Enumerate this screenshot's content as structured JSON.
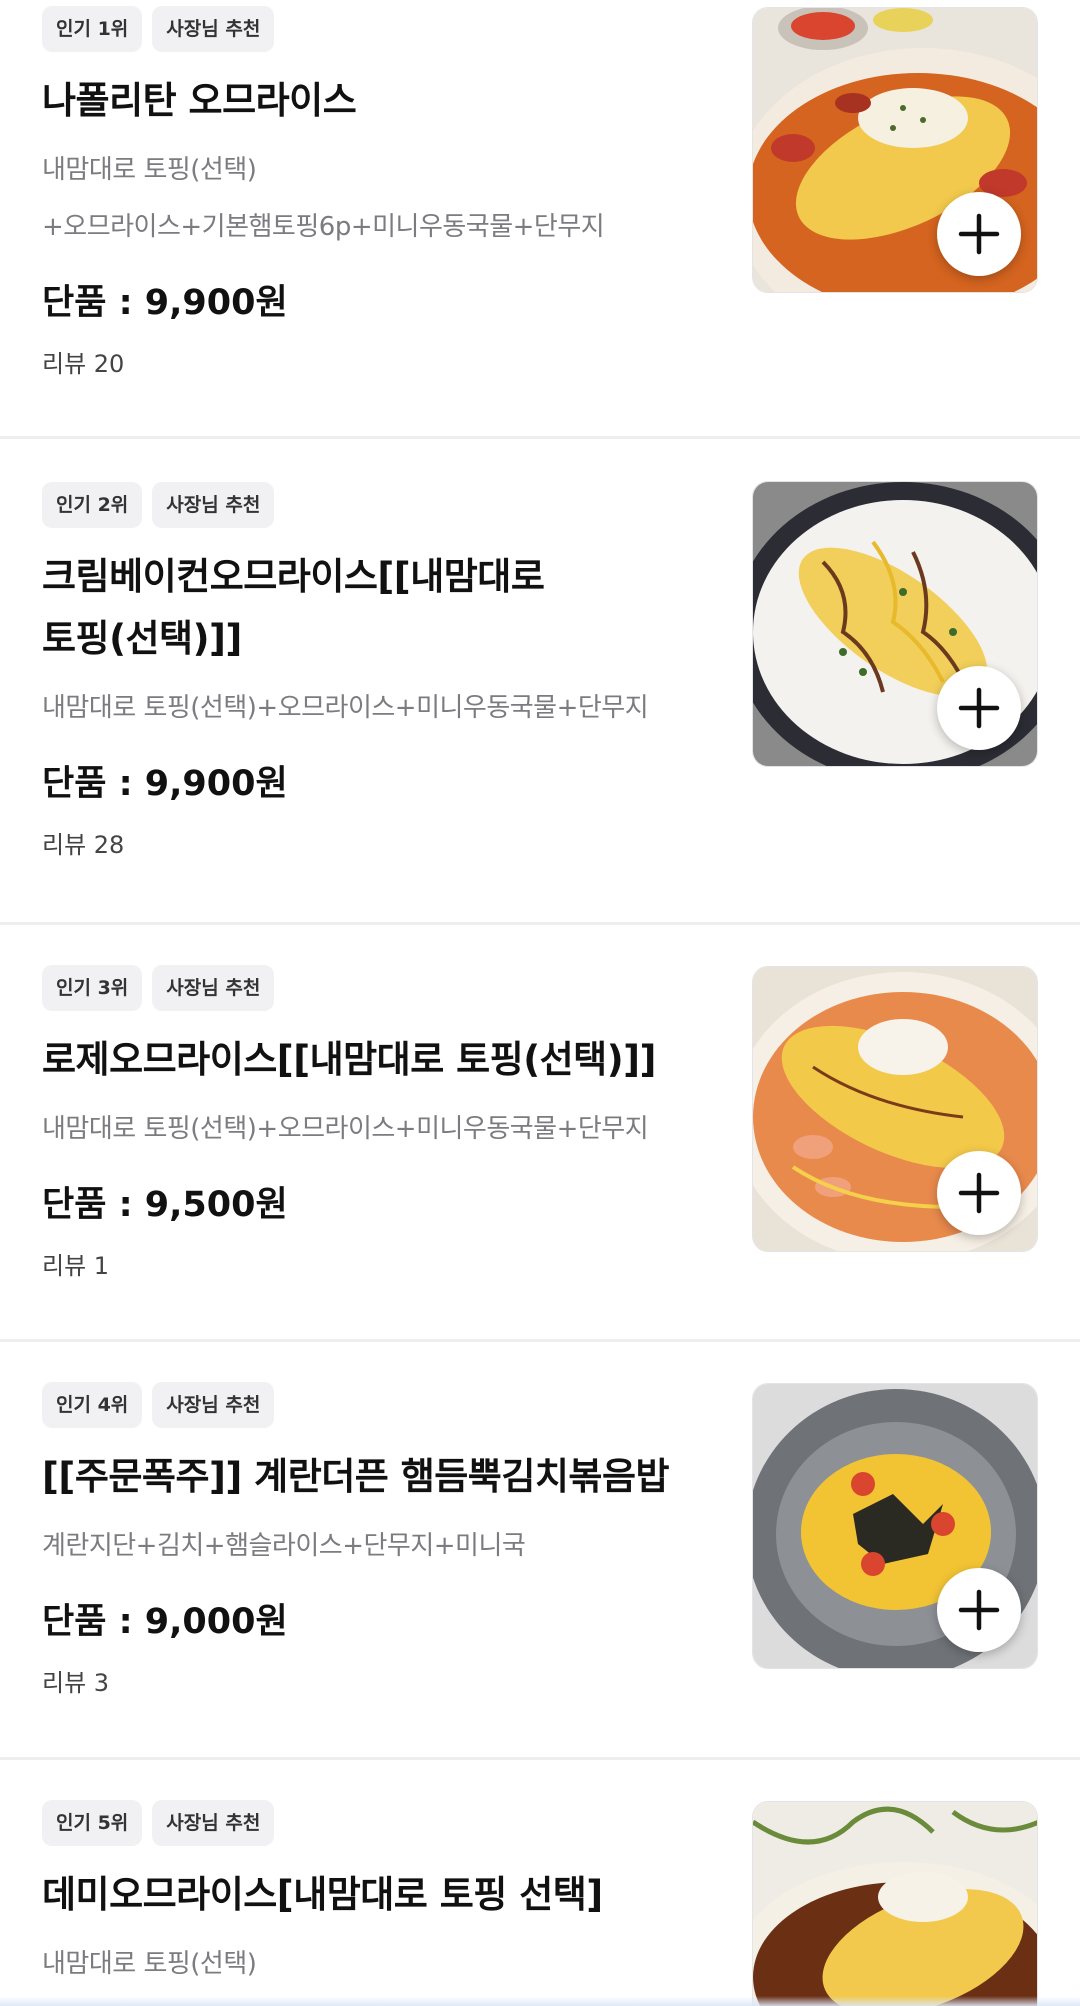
{
  "menu": {
    "items": [
      {
        "rank_tag": "인기 1위",
        "rec_tag": "사장님 추천",
        "name": "나폴리탄 오므라이스",
        "desc_lines": [
          "내맘대로 토핑(선택)",
          "+오므라이스+기본햄토핑6p+미니우동국물+단무지"
        ],
        "price": "단품 : 9,900원",
        "review": "리뷰 20",
        "image_icon": "napolitan-omurice-photo"
      },
      {
        "rank_tag": "인기 2위",
        "rec_tag": "사장님 추천",
        "name_lines": [
          "크림베이컨오므라이스[[내맘대로",
          "토핑(선택)]]"
        ],
        "desc_lines": [
          "내맘대로 토핑(선택)+오므라이스+미니우동국물+단무지"
        ],
        "price": "단품 : 9,900원",
        "review": "리뷰 28",
        "image_icon": "cream-bacon-omurice-photo"
      },
      {
        "rank_tag": "인기 3위",
        "rec_tag": "사장님 추천",
        "name": "로제오므라이스[[내맘대로 토핑(선택)]]",
        "desc_lines": [
          "내맘대로 토핑(선택)+오므라이스+미니우동국물+단무지"
        ],
        "price": "단품 : 9,500원",
        "review": "리뷰 1",
        "image_icon": "rose-omurice-photo"
      },
      {
        "rank_tag": "인기 4위",
        "rec_tag": "사장님 추천",
        "name": "[[주문폭주]] 계란더픈 햄듬뿍김치볶음밥",
        "desc_lines": [
          "계란지단+김치+햄슬라이스+단무지+미니국"
        ],
        "price": "단품 : 9,000원",
        "review": "리뷰 3",
        "image_icon": "kimchi-fried-rice-photo"
      },
      {
        "rank_tag": "인기 5위",
        "rec_tag": "사장님 추천",
        "name": "데미오므라이스[내맘대로 토핑 선택]",
        "desc_lines": [
          "내맘대로 토핑(선택)"
        ],
        "image_icon": "demi-omurice-photo"
      }
    ]
  },
  "colors": {
    "tag_bg": "#f1f1f3",
    "desc_text": "#7b7b80",
    "divider": "#eeeef0"
  }
}
